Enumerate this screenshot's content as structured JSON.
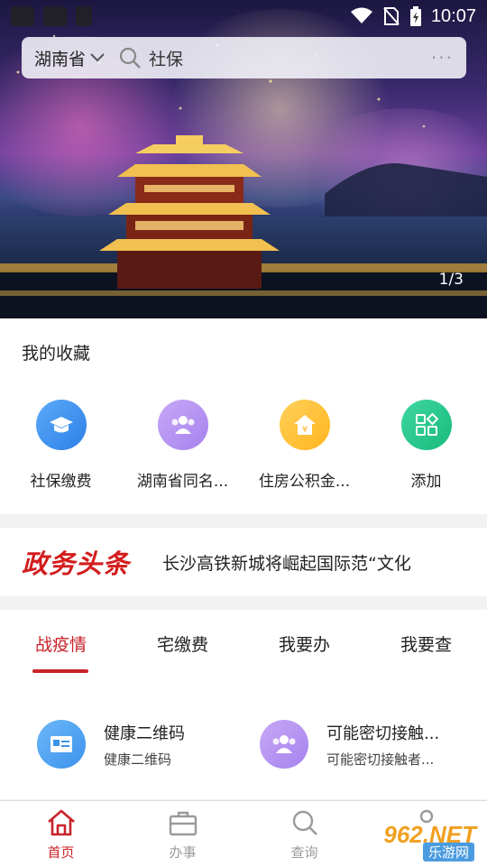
{
  "status_bar": {
    "time": "10:07"
  },
  "search": {
    "province": "湖南省",
    "query": "社保",
    "more": "···"
  },
  "banner": {
    "page_indicator": "1/3"
  },
  "favorites": {
    "title": "我的收藏",
    "items": [
      {
        "label": "社保缴费",
        "icon": "graduation-cap-icon",
        "color": "#3d8ff0"
      },
      {
        "label": "湖南省同名...",
        "icon": "group-icon",
        "color": "#b493f0"
      },
      {
        "label": "住房公积金...",
        "icon": "house-yuan-icon",
        "color": "#ffc23a"
      },
      {
        "label": "添加",
        "icon": "apps-grid-icon",
        "color": "#27c98c"
      }
    ]
  },
  "headline": {
    "brand": "政务头条",
    "news": "长沙高铁新城将崛起国际范“文化"
  },
  "tabs": [
    {
      "label": "战疫情",
      "active": true
    },
    {
      "label": "宅缴费"
    },
    {
      "label": "我要办"
    },
    {
      "label": "我要查"
    }
  ],
  "services": [
    {
      "title": "健康二维码",
      "subtitle": "健康二维码",
      "icon": "id-card-icon",
      "color": "#4ba3f2"
    },
    {
      "title": "可能密切接触...",
      "subtitle": "可能密切接触者...",
      "icon": "group-icon",
      "color": "#b493f0"
    }
  ],
  "bottom_nav": [
    {
      "label": "首页",
      "icon": "home-icon",
      "active": true
    },
    {
      "label": "办事",
      "icon": "briefcase-icon"
    },
    {
      "label": "查询",
      "icon": "search-icon"
    },
    {
      "label": "",
      "icon": "user-icon"
    }
  ],
  "watermark": {
    "line1": "962.NET",
    "line2": "乐游网"
  },
  "colors": {
    "accent": "#c8232a",
    "brand_red": "#d31c1c"
  }
}
